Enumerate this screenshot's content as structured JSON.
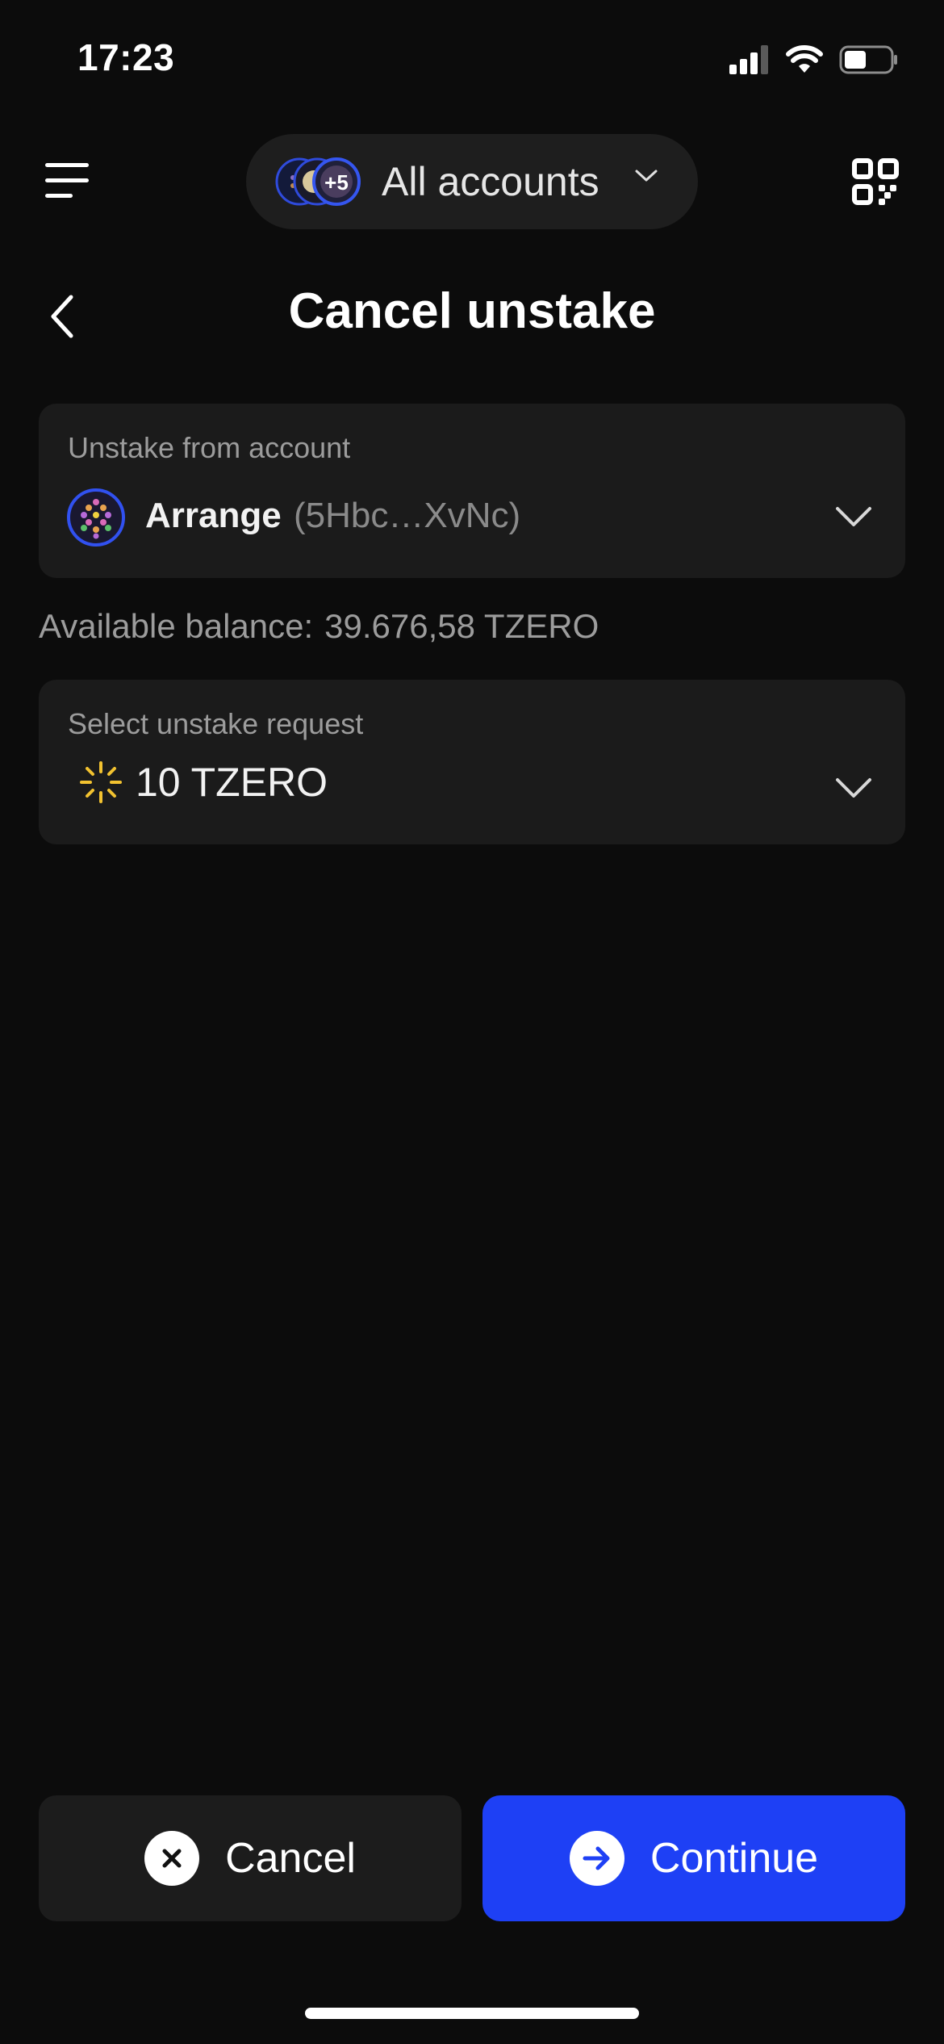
{
  "status_bar": {
    "time": "17:23"
  },
  "header": {
    "account_selector_label": "All accounts",
    "pill_badge": "+5",
    "title": "Cancel unstake"
  },
  "account_card": {
    "label": "Unstake from account",
    "account_name": "Arrange",
    "account_address": "(5Hbc…XvNc)"
  },
  "balance": {
    "label": "Available balance:",
    "value": "39.676,58 TZERO"
  },
  "request_card": {
    "label": "Select unstake request",
    "value": "10 TZERO"
  },
  "actions": {
    "cancel_label": "Cancel",
    "continue_label": "Continue"
  },
  "colors": {
    "background": "#0c0c0c",
    "card": "#1b1b1b",
    "accent_blue": "#1e40f5",
    "pending_yellow": "#f2c230"
  }
}
